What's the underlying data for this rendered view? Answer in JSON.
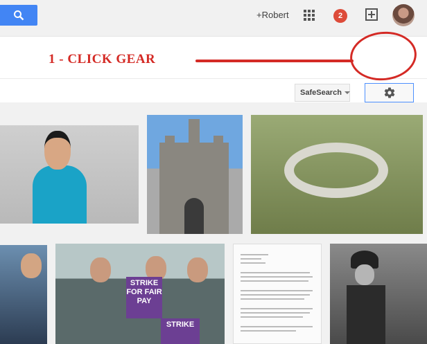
{
  "header": {
    "user_name": "+Robert",
    "notification_count": "2",
    "icons": [
      "search-icon",
      "apps-grid-icon",
      "share-plus-icon",
      "avatar"
    ]
  },
  "toolbar": {
    "safesearch_label": "SafeSearch",
    "settings_icon": "gear-icon"
  },
  "annotation": {
    "text": "1 - CLICK GEAR",
    "color": "#d42a25"
  },
  "results": {
    "sign_text_1": "STRIKE FOR FAIR PAY",
    "sign_text_2": "STRIKE"
  },
  "colors": {
    "accent": "#4285f4",
    "notification": "#dd4b39",
    "focus_border": "#4d90fe"
  }
}
